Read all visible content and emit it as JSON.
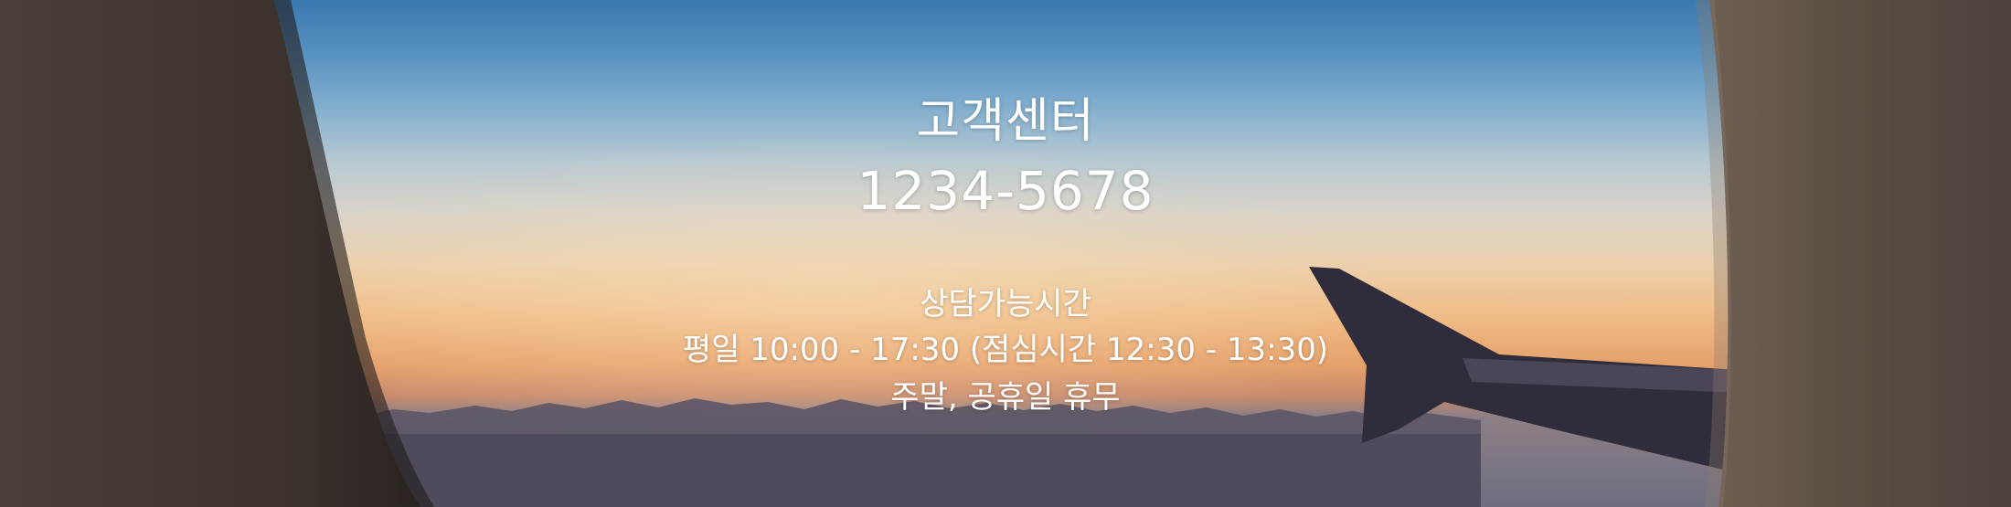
{
  "customer_center": {
    "title": "고객센터",
    "phone": "1234-5678",
    "hours_label": "상담가능시간",
    "weekday_hours": "평일 10:00 - 17:30 (점심시간 12:30 - 13:30)",
    "weekend_note": "주말, 공휴일 휴무"
  },
  "colors": {
    "text": "#ffffff",
    "sky_top": "#3a78b0",
    "sky_horizon": "#f0bd88",
    "frame": "#3f3733"
  }
}
